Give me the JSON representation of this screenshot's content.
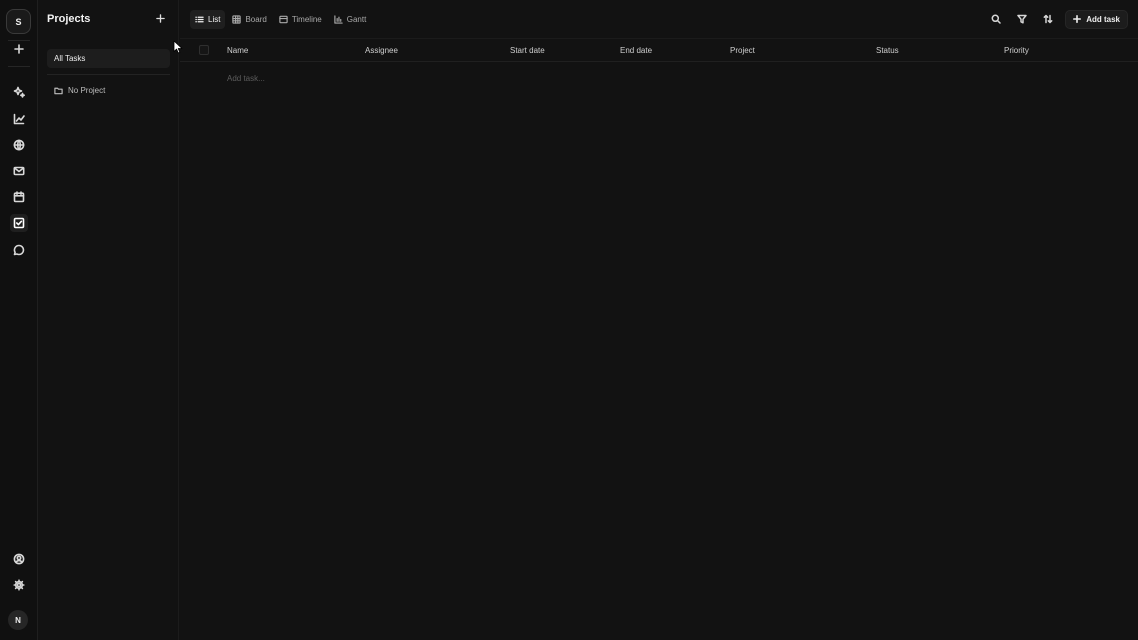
{
  "rail": {
    "workspace_initial": "S",
    "user_initial": "N",
    "icons": [
      "plus-icon",
      "sparkles-icon",
      "chart-icon",
      "globe-icon",
      "mail-icon",
      "calendar-icon",
      "tasks-icon",
      "chat-icon",
      "account-icon",
      "gear-icon"
    ],
    "active": "tasks-icon"
  },
  "sidebar": {
    "title": "Projects",
    "all_tasks": "All Tasks",
    "projects": [
      {
        "label": "No Project"
      }
    ]
  },
  "toolbar": {
    "tabs": [
      {
        "label": "List",
        "icon": "list-icon",
        "active": true
      },
      {
        "label": "Board",
        "icon": "grid-icon",
        "active": false
      },
      {
        "label": "Timeline",
        "icon": "timeline-icon",
        "active": false
      },
      {
        "label": "Gantt",
        "icon": "gantt-icon",
        "active": false
      }
    ],
    "add_task_label": "Add task"
  },
  "table": {
    "columns": [
      "Name",
      "Assignee",
      "Start date",
      "End date",
      "Project",
      "Status",
      "Priority"
    ],
    "add_row_placeholder": "Add task..."
  }
}
